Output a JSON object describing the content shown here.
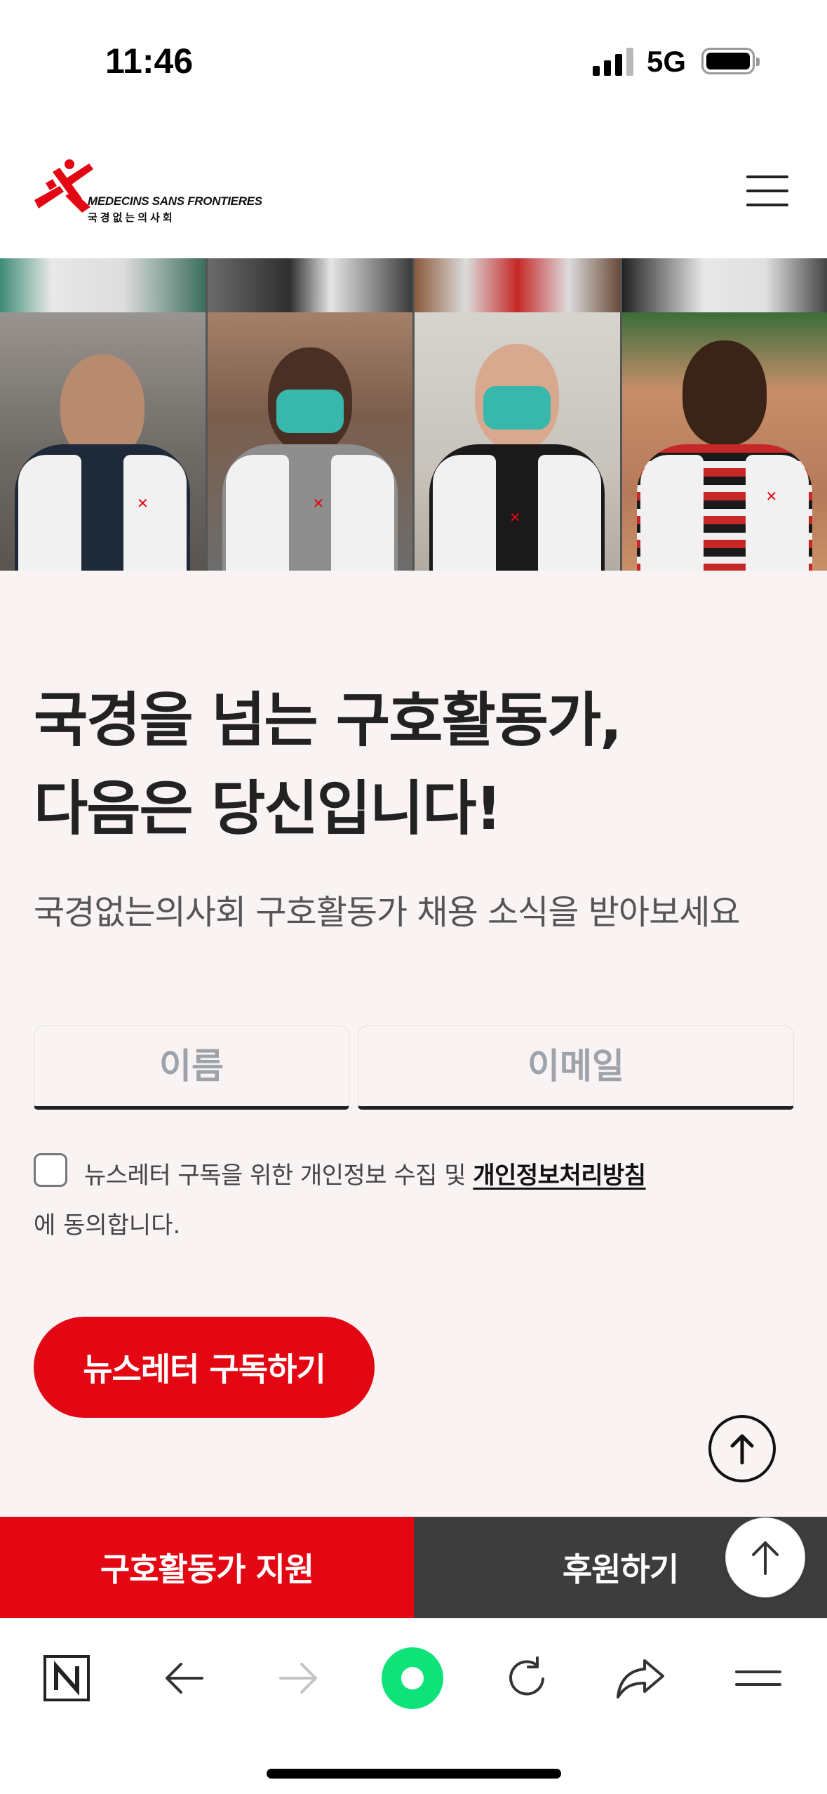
{
  "status_bar": {
    "time": "11:46",
    "network": "5G"
  },
  "header": {
    "logo_line1": "MEDECINS SANS FRONTIERES",
    "logo_line2": "국경없는의사회",
    "brand_color": "#e30613"
  },
  "hero": {
    "photo_count": 4
  },
  "main": {
    "headline_line1": "국경을 넘는 구호활동가,",
    "headline_line2": "다음은 당신입니다!",
    "subline": "국경없는의사회 구호활동가 채용 소식을 받아보세요",
    "name_placeholder": "이름",
    "email_placeholder": "이메일",
    "consent_text": "뉴스레터 구독을 위한  개인정보 수집 및 ",
    "consent_link": "개인정보처리방침",
    "consent_text_2": "에 동의합니다.",
    "subscribe_label": "뉴스레터 구독하기"
  },
  "cta_bar": {
    "volunteer_label": "구호활동가 지원",
    "donate_label": "후원하기"
  },
  "toolbar": {
    "icons": [
      "naver-n-icon",
      "back-arrow-icon",
      "forward-arrow-icon",
      "green-dot-icon",
      "refresh-icon",
      "share-icon",
      "menu-icon"
    ]
  }
}
